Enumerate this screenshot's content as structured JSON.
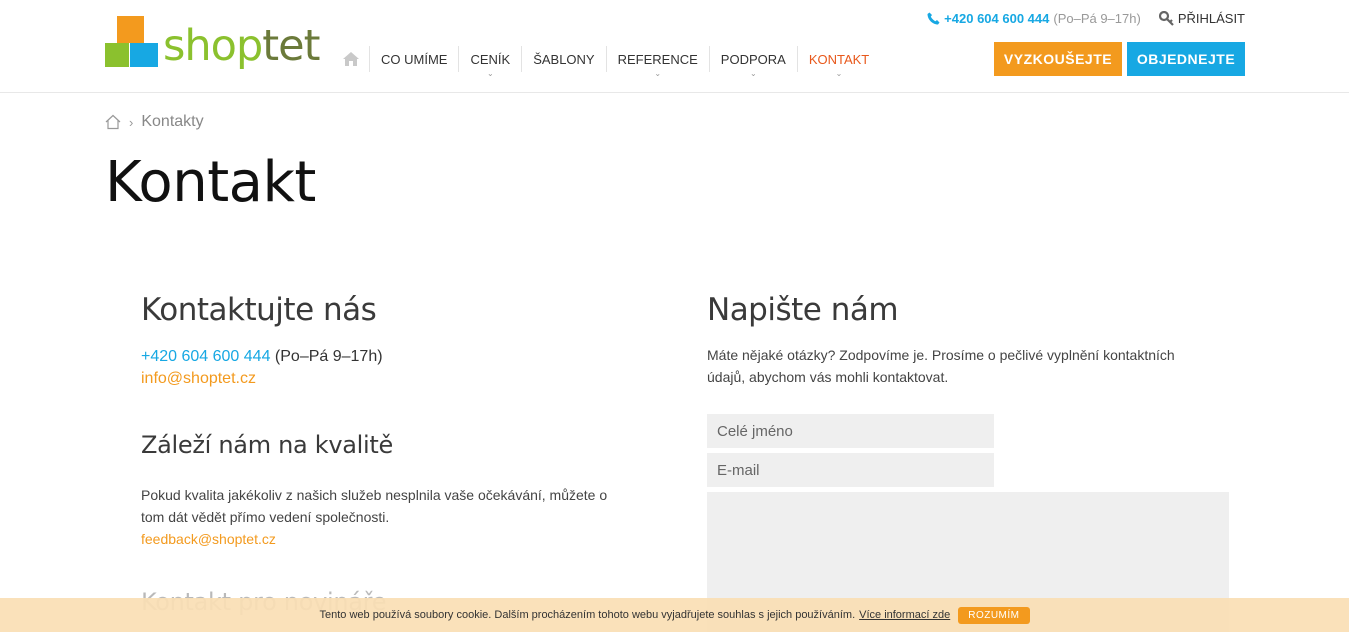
{
  "header": {
    "logo_text_a": "shop",
    "logo_text_b": "tet",
    "phone": "+420 604 600 444",
    "hours": "(Po–Pá 9–17h)",
    "login": "PŘIHLÁSIT",
    "nav": [
      {
        "label": "CO UMÍME"
      },
      {
        "label": "CENÍK"
      },
      {
        "label": "ŠABLONY"
      },
      {
        "label": "REFERENCE"
      },
      {
        "label": "PODPORA"
      },
      {
        "label": "KONTAKT"
      }
    ],
    "btn_try": "VYZKOUŠEJTE",
    "btn_order": "OBJEDNEJTE",
    "colors": {
      "orange": "#f39a1e",
      "blue": "#17a8e3",
      "green": "#8bc12e",
      "active": "#e8581b"
    }
  },
  "breadcrumb": {
    "current": "Kontakty"
  },
  "page_title": "Kontakt",
  "left": {
    "heading": "Kontaktujte nás",
    "phone": "+420 604 600 444",
    "hours": "(Po–Pá 9–17h)",
    "email": "info@shoptet.cz",
    "quality_heading": "Záleží nám na kvalitě",
    "quality_line1": "Pokud kvalita jakékoliv z našich služeb nesplnila vaše očekávání, můžete o",
    "quality_line2": "tom dát vědět přímo vedení společnosti.",
    "quality_email": "feedback@shoptet.cz",
    "press_heading": "Kontakt pro novináře"
  },
  "right": {
    "heading": "Napište nám",
    "intro_line1": "Máte nějaké otázky? Zodpovíme je. Prosíme o pečlivé vyplnění kontaktních",
    "intro_line2": "údajů, abychom vás mohli kontaktovat.",
    "name_placeholder": "Celé jméno",
    "email_placeholder": "E-mail"
  },
  "cookie": {
    "text": "Tento web používá soubory cookie. Dalším procházením tohoto webu vyjadřujete souhlas s jejich používáním.",
    "more": "Více informací zde",
    "agree": "ROZUMÍM"
  }
}
